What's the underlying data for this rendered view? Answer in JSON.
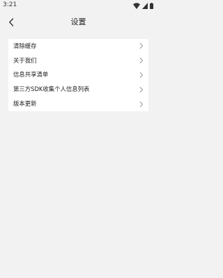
{
  "status_bar": {
    "time": "3:21",
    "icons": [
      "wifi-icon",
      "signal-icon",
      "battery-icon"
    ]
  },
  "header": {
    "back_icon": "chevron-left-icon",
    "title": "设置"
  },
  "settings": {
    "items": [
      {
        "label": "清除缓存"
      },
      {
        "label": "关于我们"
      },
      {
        "label": "信息共享清单"
      },
      {
        "label": "第三方SDK收集个人信息列表"
      },
      {
        "label": "版本更新"
      }
    ]
  },
  "colors": {
    "background": "#f2f2f2",
    "card": "#ffffff",
    "text": "#222222",
    "chevron": "#9a9a9a"
  }
}
